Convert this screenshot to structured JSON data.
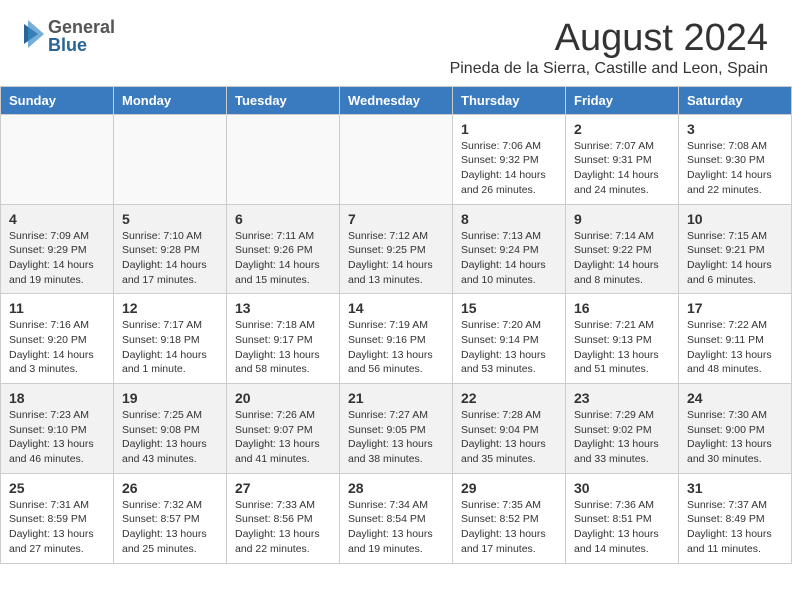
{
  "header": {
    "logo_general": "General",
    "logo_blue": "Blue",
    "month_year": "August 2024",
    "location": "Pineda de la Sierra, Castille and Leon, Spain"
  },
  "days_of_week": [
    "Sunday",
    "Monday",
    "Tuesday",
    "Wednesday",
    "Thursday",
    "Friday",
    "Saturday"
  ],
  "weeks": [
    [
      {
        "day": "",
        "info": ""
      },
      {
        "day": "",
        "info": ""
      },
      {
        "day": "",
        "info": ""
      },
      {
        "day": "",
        "info": ""
      },
      {
        "day": "1",
        "info": "Sunrise: 7:06 AM\nSunset: 9:32 PM\nDaylight: 14 hours\nand 26 minutes."
      },
      {
        "day": "2",
        "info": "Sunrise: 7:07 AM\nSunset: 9:31 PM\nDaylight: 14 hours\nand 24 minutes."
      },
      {
        "day": "3",
        "info": "Sunrise: 7:08 AM\nSunset: 9:30 PM\nDaylight: 14 hours\nand 22 minutes."
      }
    ],
    [
      {
        "day": "4",
        "info": "Sunrise: 7:09 AM\nSunset: 9:29 PM\nDaylight: 14 hours\nand 19 minutes."
      },
      {
        "day": "5",
        "info": "Sunrise: 7:10 AM\nSunset: 9:28 PM\nDaylight: 14 hours\nand 17 minutes."
      },
      {
        "day": "6",
        "info": "Sunrise: 7:11 AM\nSunset: 9:26 PM\nDaylight: 14 hours\nand 15 minutes."
      },
      {
        "day": "7",
        "info": "Sunrise: 7:12 AM\nSunset: 9:25 PM\nDaylight: 14 hours\nand 13 minutes."
      },
      {
        "day": "8",
        "info": "Sunrise: 7:13 AM\nSunset: 9:24 PM\nDaylight: 14 hours\nand 10 minutes."
      },
      {
        "day": "9",
        "info": "Sunrise: 7:14 AM\nSunset: 9:22 PM\nDaylight: 14 hours\nand 8 minutes."
      },
      {
        "day": "10",
        "info": "Sunrise: 7:15 AM\nSunset: 9:21 PM\nDaylight: 14 hours\nand 6 minutes."
      }
    ],
    [
      {
        "day": "11",
        "info": "Sunrise: 7:16 AM\nSunset: 9:20 PM\nDaylight: 14 hours\nand 3 minutes."
      },
      {
        "day": "12",
        "info": "Sunrise: 7:17 AM\nSunset: 9:18 PM\nDaylight: 14 hours\nand 1 minute."
      },
      {
        "day": "13",
        "info": "Sunrise: 7:18 AM\nSunset: 9:17 PM\nDaylight: 13 hours\nand 58 minutes."
      },
      {
        "day": "14",
        "info": "Sunrise: 7:19 AM\nSunset: 9:16 PM\nDaylight: 13 hours\nand 56 minutes."
      },
      {
        "day": "15",
        "info": "Sunrise: 7:20 AM\nSunset: 9:14 PM\nDaylight: 13 hours\nand 53 minutes."
      },
      {
        "day": "16",
        "info": "Sunrise: 7:21 AM\nSunset: 9:13 PM\nDaylight: 13 hours\nand 51 minutes."
      },
      {
        "day": "17",
        "info": "Sunrise: 7:22 AM\nSunset: 9:11 PM\nDaylight: 13 hours\nand 48 minutes."
      }
    ],
    [
      {
        "day": "18",
        "info": "Sunrise: 7:23 AM\nSunset: 9:10 PM\nDaylight: 13 hours\nand 46 minutes."
      },
      {
        "day": "19",
        "info": "Sunrise: 7:25 AM\nSunset: 9:08 PM\nDaylight: 13 hours\nand 43 minutes."
      },
      {
        "day": "20",
        "info": "Sunrise: 7:26 AM\nSunset: 9:07 PM\nDaylight: 13 hours\nand 41 minutes."
      },
      {
        "day": "21",
        "info": "Sunrise: 7:27 AM\nSunset: 9:05 PM\nDaylight: 13 hours\nand 38 minutes."
      },
      {
        "day": "22",
        "info": "Sunrise: 7:28 AM\nSunset: 9:04 PM\nDaylight: 13 hours\nand 35 minutes."
      },
      {
        "day": "23",
        "info": "Sunrise: 7:29 AM\nSunset: 9:02 PM\nDaylight: 13 hours\nand 33 minutes."
      },
      {
        "day": "24",
        "info": "Sunrise: 7:30 AM\nSunset: 9:00 PM\nDaylight: 13 hours\nand 30 minutes."
      }
    ],
    [
      {
        "day": "25",
        "info": "Sunrise: 7:31 AM\nSunset: 8:59 PM\nDaylight: 13 hours\nand 27 minutes."
      },
      {
        "day": "26",
        "info": "Sunrise: 7:32 AM\nSunset: 8:57 PM\nDaylight: 13 hours\nand 25 minutes."
      },
      {
        "day": "27",
        "info": "Sunrise: 7:33 AM\nSunset: 8:56 PM\nDaylight: 13 hours\nand 22 minutes."
      },
      {
        "day": "28",
        "info": "Sunrise: 7:34 AM\nSunset: 8:54 PM\nDaylight: 13 hours\nand 19 minutes."
      },
      {
        "day": "29",
        "info": "Sunrise: 7:35 AM\nSunset: 8:52 PM\nDaylight: 13 hours\nand 17 minutes."
      },
      {
        "day": "30",
        "info": "Sunrise: 7:36 AM\nSunset: 8:51 PM\nDaylight: 13 hours\nand 14 minutes."
      },
      {
        "day": "31",
        "info": "Sunrise: 7:37 AM\nSunset: 8:49 PM\nDaylight: 13 hours\nand 11 minutes."
      }
    ]
  ]
}
